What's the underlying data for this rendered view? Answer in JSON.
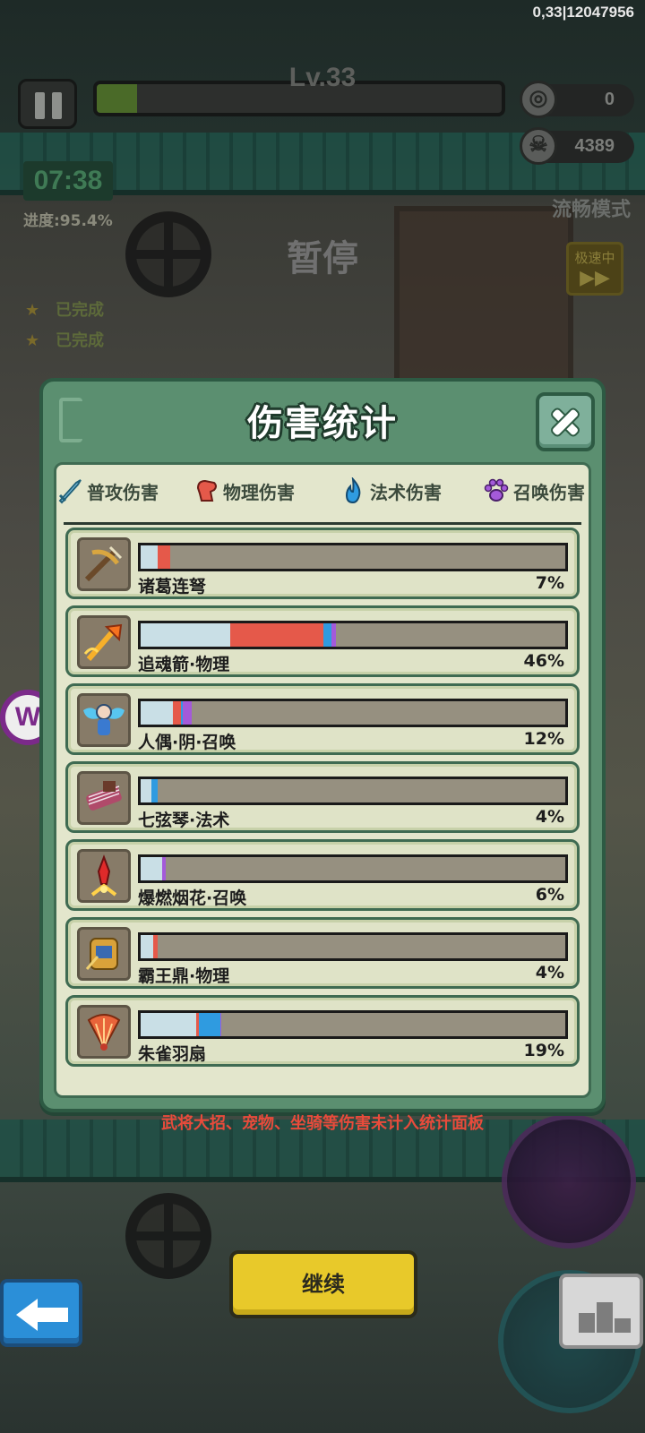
{
  "status_bar": {
    "text": "0,33|12047956"
  },
  "hud": {
    "level": "Lv.33",
    "level_progress_pct": 10,
    "coins": "0",
    "kills": "4389",
    "timer": "07:38",
    "progress_text": "进度:95.4%",
    "mode_text": "流畅模式",
    "paused_text": "暂停",
    "speed_text": "极速中",
    "quests": [
      "已完成",
      "已完成"
    ]
  },
  "dialog": {
    "title": "伤害统计",
    "legend": [
      {
        "label": "普攻伤害",
        "icon": "sword-icon",
        "color": "#c9dfe6"
      },
      {
        "label": "物理伤害",
        "icon": "fist-icon",
        "color": "#e5594a"
      },
      {
        "label": "法术伤害",
        "icon": "flame-icon",
        "color": "#2f9be0"
      },
      {
        "label": "召唤伤害",
        "icon": "paw-icon",
        "color": "#a45ad9"
      }
    ],
    "rows": [
      {
        "name": "诸葛连弩",
        "percent": "7%",
        "icon": "crossbow-icon",
        "segments": [
          {
            "type": "普攻伤害",
            "value": 4
          },
          {
            "type": "物理伤害",
            "value": 3
          }
        ]
      },
      {
        "name": "追魂箭·物理",
        "percent": "46%",
        "icon": "flaming-arrow-icon",
        "segments": [
          {
            "type": "普攻伤害",
            "value": 21
          },
          {
            "type": "物理伤害",
            "value": 22
          },
          {
            "type": "法术伤害",
            "value": 2
          },
          {
            "type": "召唤伤害",
            "value": 1
          }
        ]
      },
      {
        "name": "人偶·阴·召唤",
        "percent": "12%",
        "icon": "doll-icon",
        "segments": [
          {
            "type": "普攻伤害",
            "value": 7.5
          },
          {
            "type": "物理伤害",
            "value": 2
          },
          {
            "type": "法术伤害",
            "value": 0.5
          },
          {
            "type": "召唤伤害",
            "value": 2
          }
        ]
      },
      {
        "name": "七弦琴·法术",
        "percent": "4%",
        "icon": "zither-icon",
        "segments": [
          {
            "type": "普攻伤害",
            "value": 2.5
          },
          {
            "type": "法术伤害",
            "value": 1.5
          }
        ]
      },
      {
        "name": "爆燃烟花·召唤",
        "percent": "6%",
        "icon": "firework-icon",
        "segments": [
          {
            "type": "普攻伤害",
            "value": 5
          },
          {
            "type": "召唤伤害",
            "value": 1
          }
        ]
      },
      {
        "name": "霸王鼎·物理",
        "percent": "4%",
        "icon": "cauldron-icon",
        "segments": [
          {
            "type": "普攻伤害",
            "value": 3
          },
          {
            "type": "物理伤害",
            "value": 1
          }
        ]
      },
      {
        "name": "朱雀羽扇",
        "percent": "19%",
        "icon": "feather-fan-icon",
        "segments": [
          {
            "type": "普攻伤害",
            "value": 13
          },
          {
            "type": "物理伤害",
            "value": 0.7
          },
          {
            "type": "法术伤害",
            "value": 5
          },
          {
            "type": "召唤伤害",
            "value": 0.3
          }
        ]
      }
    ]
  },
  "note": "武将大招、宠物、坐骑等伤害未计入统计面板",
  "buttons": {
    "continue": "继续"
  },
  "colors": {
    "normal": "#c9dfe6",
    "physical": "#e5594a",
    "magic": "#2f9be0",
    "summon": "#a45ad9",
    "bar_empty": "#969080",
    "note": "#e84b3b"
  }
}
